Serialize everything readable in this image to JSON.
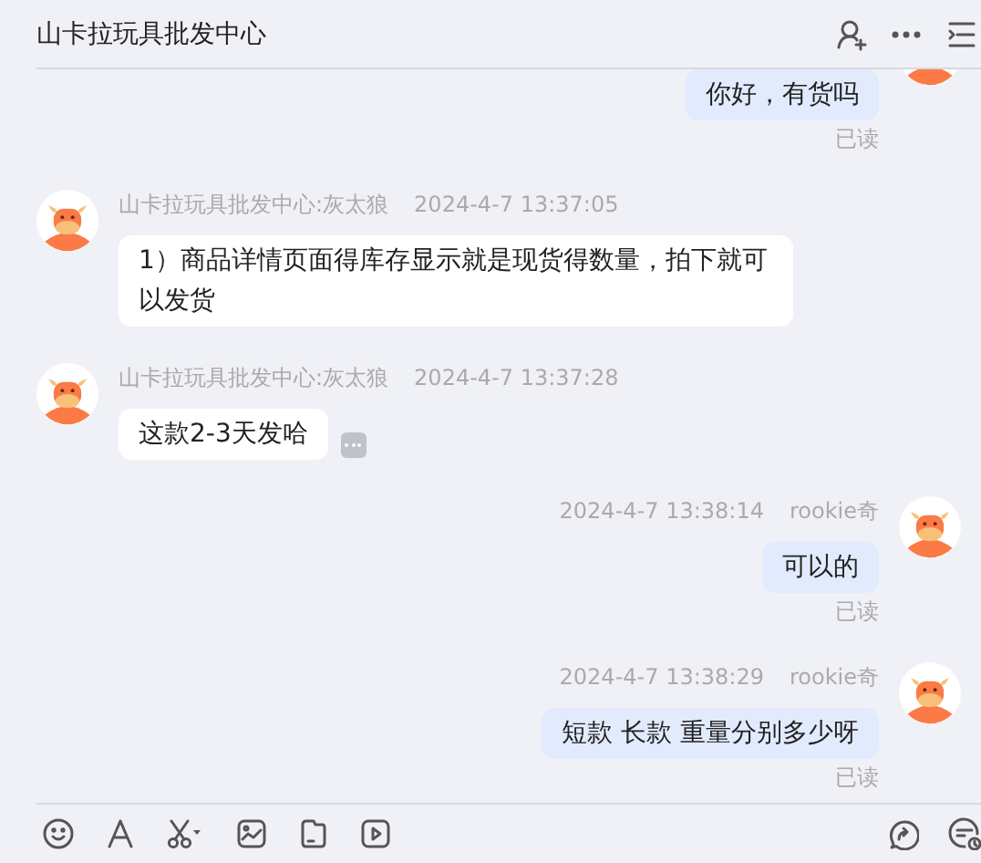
{
  "header": {
    "title": "山卡拉玩具批发中心"
  },
  "messages": [
    {
      "kind": "outgoing",
      "text": "你好，有货吗",
      "status": "已读",
      "has_more_button": false
    },
    {
      "kind": "incoming",
      "sender": "山卡拉玩具批发中心:灰太狼",
      "time": "2024-4-7 13:37:05",
      "text": "1）商品详情页面得库存显示就是现货得数量，拍下就可以发货",
      "has_more_button": false
    },
    {
      "kind": "incoming",
      "sender": "山卡拉玩具批发中心:灰太狼",
      "time": "2024-4-7 13:37:28",
      "text": "这款2-3天发哈",
      "has_more_button": true
    },
    {
      "kind": "outgoing",
      "sender": "rookie奇",
      "time": "2024-4-7 13:38:14",
      "text": "可以的",
      "status": "已读",
      "has_more_button": false
    },
    {
      "kind": "outgoing",
      "sender": "rookie奇",
      "time": "2024-4-7 13:38:29",
      "text": "短款 长款 重量分别多少呀",
      "status": "已读",
      "has_more_button": false
    }
  ]
}
